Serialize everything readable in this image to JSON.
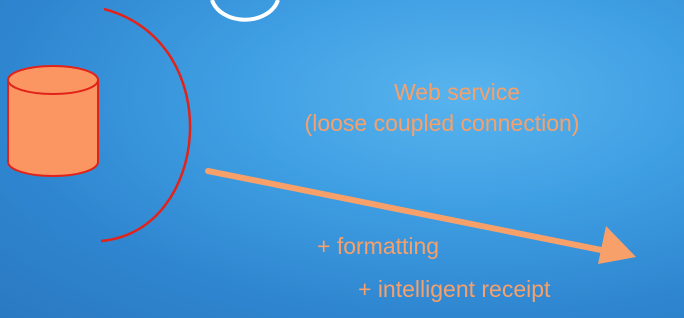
{
  "labels": {
    "service_title": "Web service",
    "service_subtitle": "(loose coupled connection)",
    "formatting_note": "+ formatting",
    "receipt_note": "+ intelligent receipt"
  },
  "colors": {
    "accent_orange": "#f7a06a",
    "database_fill": "#fb9561",
    "database_stroke": "#e2231a",
    "bracket_stroke": "#e2231a",
    "arrow": "#f7a06a"
  },
  "icons": [
    "database-icon",
    "partial-circle-icon"
  ]
}
